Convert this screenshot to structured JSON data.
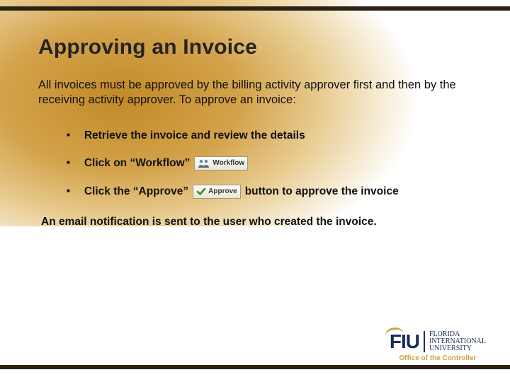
{
  "title": "Approving an Invoice",
  "intro": "All invoices must be approved by the billing activity approver first and then by the receiving activity approver. To approve an invoice:",
  "bullets": {
    "b1": "Retrieve the invoice and review the details",
    "b2_pre": "Click on “Workflow”",
    "b2_chip": "Workflow",
    "b3_pre": "Click the “Approve”",
    "b3_chip": "Approve",
    "b3_post": "button to approve the invoice"
  },
  "closing": "An email notification is sent to the user who created the invoice.",
  "logo": {
    "mark": "FIU",
    "line1": "Florida",
    "line2": "International",
    "line3": "University",
    "office": "Office of the Controller"
  }
}
